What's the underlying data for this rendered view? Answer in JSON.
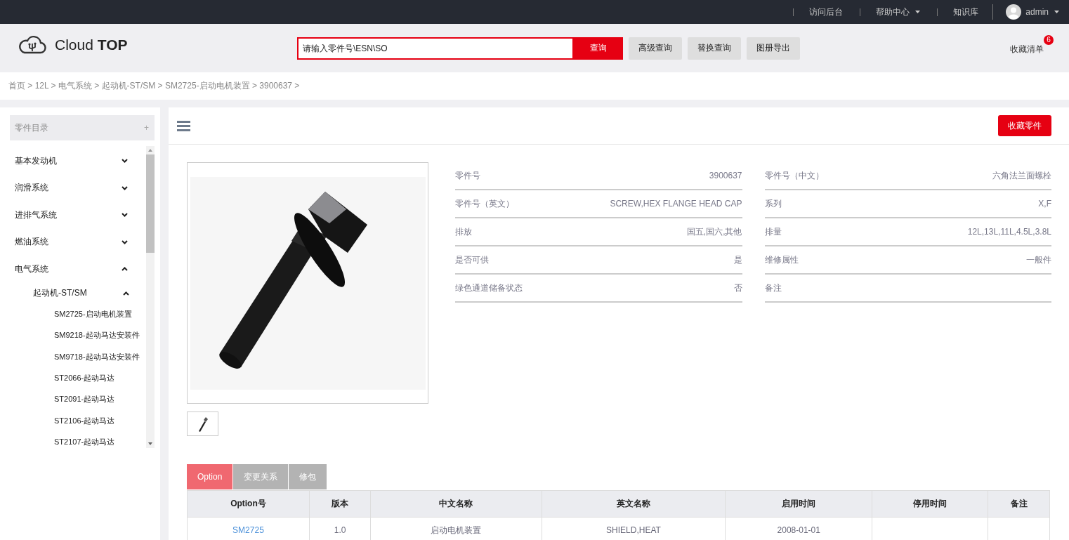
{
  "top_bar": {
    "links": [
      {
        "label": "访问后台",
        "dropdown": false
      },
      {
        "label": "帮助中心",
        "dropdown": true
      },
      {
        "label": "知识库",
        "dropdown": false
      }
    ],
    "user": {
      "name": "admin"
    }
  },
  "header": {
    "logo": "Cloud **TOP**",
    "search": {
      "placeholder": "请输入零件号\\ESN\\SO",
      "button": "查询"
    },
    "buttons": [
      "高级查询",
      "替换查询",
      "图册导出"
    ],
    "favorites": {
      "label": "收藏清单",
      "count": "6"
    }
  },
  "breadcrumb": "首页 > 12L > 电气系统 > 起动机-ST/SM > SM2725-启动电机装置 > 3900637 >",
  "sidebar": {
    "title": "零件目录",
    "toggle": "+",
    "items": [
      {
        "label": "基本发动机",
        "expanded": false
      },
      {
        "label": "润滑系统",
        "expanded": false
      },
      {
        "label": "进排气系统",
        "expanded": false
      },
      {
        "label": "燃油系统",
        "expanded": false
      },
      {
        "label": "电气系统",
        "expanded": true,
        "children": [
          {
            "label": "起动机-ST/SM",
            "expanded": true,
            "children": [
              {
                "label": "SM2725-启动电机装置"
              },
              {
                "label": "SM9218-起动马达安装件"
              },
              {
                "label": "SM9718-起动马达安装件"
              },
              {
                "label": "ST2066-起动马达"
              },
              {
                "label": "ST2091-起动马达"
              },
              {
                "label": "ST2106-起动马达"
              },
              {
                "label": "ST2107-起动马达"
              }
            ]
          }
        ]
      }
    ]
  },
  "detail": {
    "favorite_button": "收藏零件",
    "fields": [
      [
        {
          "label": "零件号",
          "value": "3900637"
        },
        {
          "label": "零件号（英文）",
          "value": "SCREW,HEX FLANGE HEAD CAP"
        },
        {
          "label": "排放",
          "value": "国五,国六,其他"
        },
        {
          "label": "是否可供",
          "value": "是"
        },
        {
          "label": "绿色通道储备状态",
          "value": "否"
        }
      ],
      [
        {
          "label": "零件号（中文）",
          "value": "六角法兰面螺栓"
        },
        {
          "label": "系列",
          "value": "X,F"
        },
        {
          "label": "排量",
          "value": "12L,13L,11L,4.5L,3.8L"
        },
        {
          "label": "维修属性",
          "value": "一般件"
        },
        {
          "label": "备注"
        }
      ]
    ]
  },
  "tabs": [
    {
      "label": "Option",
      "selected": true
    },
    {
      "label": "变更关系",
      "selected": false
    },
    {
      "label": "修包",
      "selected": false
    }
  ],
  "table": {
    "columns": [
      "Option号",
      "版本",
      "中文名称",
      "英文名称",
      "启用时间",
      "停用时间",
      "备注"
    ],
    "rows": [
      [
        {
          "text": "SM2725",
          "kind": "link"
        },
        {
          "text": "1.0",
          "kind": "text"
        },
        {
          "text": "启动电机装置",
          "kind": "text"
        },
        {
          "text": "SHIELD,HEAT",
          "kind": "text"
        },
        {
          "text": "2008-01-01",
          "kind": "text"
        },
        null,
        null
      ]
    ]
  }
}
